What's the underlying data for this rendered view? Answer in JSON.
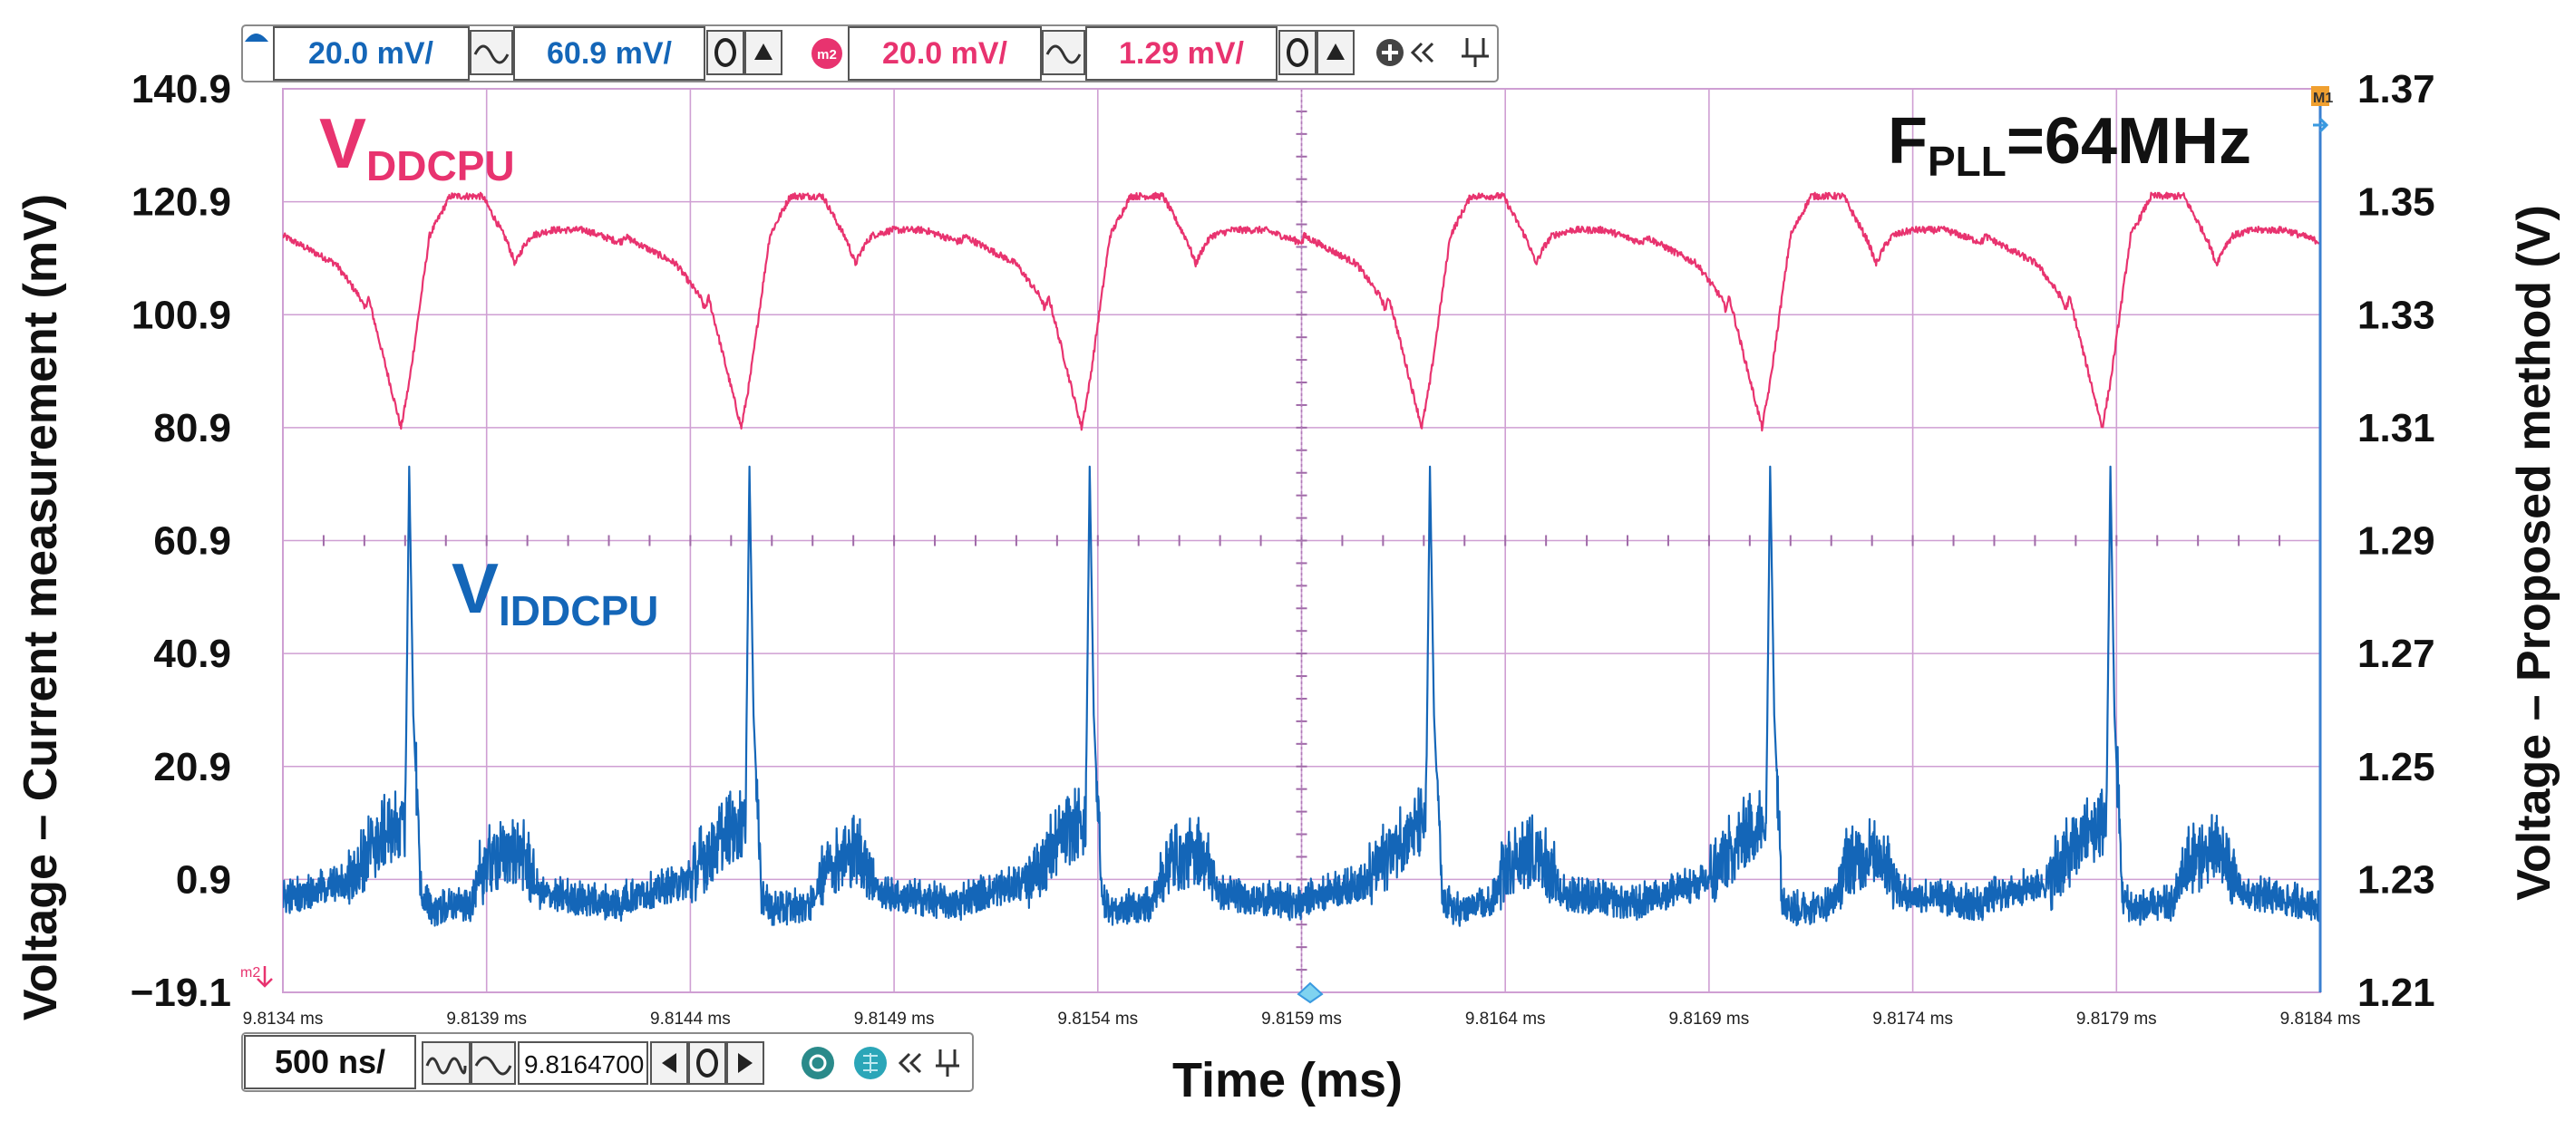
{
  "scope": {
    "top_toolbar": {
      "ch1_scale": "20.0 mV/",
      "ch1_offset": "60.9 mV/",
      "math_label": "m2",
      "ch2_scale": "20.0 mV/",
      "ch2_offset": "1.29 mV/"
    },
    "bottom_toolbar": {
      "timebase": "500 ns/",
      "position": "9.8164700"
    },
    "markers": {
      "trigger": "M1",
      "math_ref": "m2"
    },
    "colors": {
      "ddcpu": "#e8336f",
      "iddcpu": "#1466b8",
      "grid": "#cf9fd3",
      "toolbar_pink": "#e8336f",
      "toolbar_blue": "#1466b8"
    }
  },
  "chart_data": {
    "type": "line",
    "xlabel": "Time (ms)",
    "ylabel_left": "Voltage – Current measurement (mV)",
    "ylabel_right": "Voltage – Proposed method (V)",
    "xlim": [
      9.8134,
      9.8184
    ],
    "ylim_left": [
      -19.1,
      140.9
    ],
    "ylim_right": [
      1.21,
      1.37
    ],
    "x_ticks": [
      "9.8134 ms",
      "9.8139 ms",
      "9.8144 ms",
      "9.8149 ms",
      "9.8154 ms",
      "9.8159 ms",
      "9.8164 ms",
      "9.8169 ms",
      "9.8174 ms",
      "9.8179 ms",
      "9.8184 ms"
    ],
    "y_ticks_left": [
      "140.9",
      "120.9",
      "100.9",
      "80.9",
      "60.9",
      "40.9",
      "20.9",
      "0.9",
      "−19.1"
    ],
    "y_ticks_right": [
      "1.37",
      "1.35",
      "1.33",
      "1.31",
      "1.29",
      "1.27",
      "1.25",
      "1.23",
      "1.21"
    ],
    "annotation": {
      "main": "F",
      "sub": "PLL",
      "rest": "=64MHz"
    },
    "grid": true,
    "series": [
      {
        "name_main": "V",
        "name_sub": "DDCPU",
        "axis": "right",
        "period_ms": 0.000835,
        "first_dip_ms": 9.81369,
        "dip_v": 1.31,
        "baseline_v": 1.344,
        "peak_v": 1.352,
        "x": [
          9.8134,
          9.81353,
          9.81359,
          9.8136,
          9.81361,
          9.81369,
          9.81371,
          9.81376,
          9.81381,
          9.81389,
          9.81395,
          9.81397,
          9.81399,
          9.81401,
          9.81406,
          9.81414,
          9.81422
        ],
        "y": [
          1.344,
          1.339,
          1.333,
          1.331,
          1.333,
          1.31,
          1.318,
          1.344,
          1.351,
          1.351,
          1.343,
          1.339,
          1.342,
          1.344,
          1.345,
          1.345,
          1.343
        ]
      },
      {
        "name_main": "V",
        "name_sub": "IDDCPU",
        "axis": "left",
        "period_ms": 0.000835,
        "first_spike_ms": 9.81371,
        "spike_mv": 74,
        "baseline_mv": -5,
        "burst_peak_mv": 10,
        "x": [
          9.8134,
          9.81356,
          9.81365,
          9.8137,
          9.81371,
          9.81372,
          9.81374,
          9.81377,
          9.81386,
          9.8139,
          9.81398,
          9.81403,
          9.81422
        ],
        "y": [
          -3,
          0,
          8,
          10,
          74,
          30,
          -3,
          -5,
          -4,
          3,
          5,
          -2,
          -4
        ]
      }
    ]
  }
}
